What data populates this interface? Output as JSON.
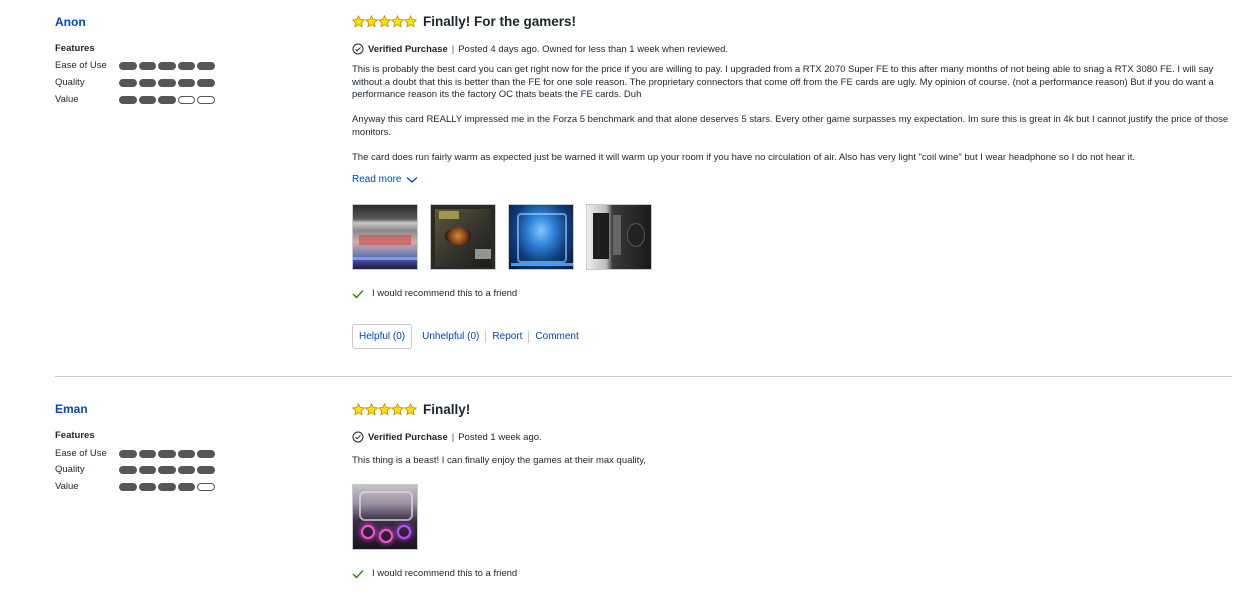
{
  "colors": {
    "link": "#0046be",
    "star": "#ffe000",
    "bar": "#55555a",
    "check": "#318000"
  },
  "icons": {
    "star": "star-icon",
    "verified": "check-circle-icon",
    "recommend": "checkmark-icon",
    "expand": "chevron-down-icon"
  },
  "reviews": [
    {
      "author": "Anon",
      "features_title": "Features",
      "features": [
        {
          "label": "Ease of Use",
          "rating": 5
        },
        {
          "label": "Quality",
          "rating": 5
        },
        {
          "label": "Value",
          "rating": 3
        }
      ],
      "stars": 5,
      "title": "Finally! For the gamers!",
      "verified_label": "Verified Purchase",
      "posted": "Posted 4 days ago. Owned for less than 1 week when reviewed.",
      "paragraphs": [
        "This is probably the best card you can get right now for the price if you are willing to pay. I upgraded from a RTX 2070 Super FE to this after many months of not being able to snag a RTX 3080 FE. I will say without a doubt that this is better than the FE for one sole reason. The proprietary connectors that come off from the FE cards are ugly. My opinion of course. (not a performance reason) But if you do want a performance reason its the factory OC thats beats the FE cards. Duh",
        "Anyway this card REALLY impressed me in the Forza 5 benchmark and that alone deserves 5 stars. Every other game surpasses my expectation. Im sure this is great in 4k but I cannot justify the price of those monitors.",
        "The card does run fairly warm as expected just be warned it will warm up your room if you have no circulation of air. Also has  very light \"coil wine\" but I wear headphone so I do not hear it."
      ],
      "read_more": "Read more",
      "photo_count": 4,
      "recommend": "I would recommend this to a friend",
      "actions": {
        "helpful": "Helpful (0)",
        "unhelpful": "Unhelpful (0)",
        "report": "Report",
        "comment": "Comment"
      }
    },
    {
      "author": "Eman",
      "features_title": "Features",
      "features": [
        {
          "label": "Ease of Use",
          "rating": 5
        },
        {
          "label": "Quality",
          "rating": 5
        },
        {
          "label": "Value",
          "rating": 4
        }
      ],
      "stars": 5,
      "title": "Finally!",
      "verified_label": "Verified Purchase",
      "posted": "Posted 1 week ago.",
      "paragraphs": [
        "This thing is a beast! I can finally enjoy the games at their max quality,"
      ],
      "photo_count": 1,
      "recommend": "I would recommend this to a friend"
    }
  ]
}
